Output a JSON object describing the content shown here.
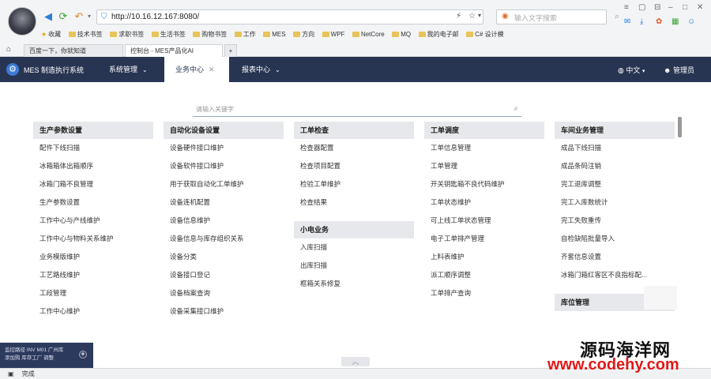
{
  "browser": {
    "url": "http://10.16.12.167:8080/",
    "search_placeholder": "输入文字搜索",
    "bookmarks": [
      {
        "label": "收藏",
        "icon": "star-icon"
      },
      {
        "label": "技术书签",
        "icon": "folder-icon"
      },
      {
        "label": "求职书签",
        "icon": "folder-icon"
      },
      {
        "label": "生活书签",
        "icon": "folder-icon"
      },
      {
        "label": "购物书签",
        "icon": "folder-icon"
      },
      {
        "label": "工作",
        "icon": "folder-icon"
      },
      {
        "label": "MES",
        "icon": "folder-icon"
      },
      {
        "label": "方向",
        "icon": "folder-icon"
      },
      {
        "label": "WPF",
        "icon": "folder-icon"
      },
      {
        "label": "NetCore",
        "icon": "folder-icon"
      },
      {
        "label": "MQ",
        "icon": "folder-icon"
      },
      {
        "label": "我的电子邮",
        "icon": "folder-icon"
      },
      {
        "label": "C# 设计模",
        "icon": "folder-icon"
      }
    ],
    "tabs": [
      {
        "label": "百度一下，你就知道"
      },
      {
        "label": "控制台 - MES产品化AI"
      }
    ],
    "status_text": "完成"
  },
  "app": {
    "title": "MES 制造执行系统",
    "menus": [
      {
        "label": "系统管理",
        "active": false
      },
      {
        "label": "业务中心",
        "active": true
      },
      {
        "label": "报表中心",
        "active": false
      }
    ],
    "language": "中文",
    "user": "管理员",
    "search_placeholder": "请输入关键字"
  },
  "columns": [
    [
      {
        "title": "生产参数设置",
        "items": [
          "配件下线扫描",
          "冰箱箱体出箱顺序",
          "冰箱门箱不良管理",
          "生产参数设置",
          "工作中心与产线维护",
          "工作中心与物料关系维护",
          "业务模版维护",
          "工艺路线维护",
          "工段管理",
          "工作中心维护"
        ]
      }
    ],
    [
      {
        "title": "自动化设备设置",
        "items": [
          "设备硬件接口维护",
          "设备软件接口维护",
          "用于获取自动化工单维护",
          "设备连机配置",
          "设备信息维护",
          "设备信息与库存组织关系",
          "设备分类",
          "设备接口登记",
          "设备档案查询",
          "设备采集接口维护"
        ]
      }
    ],
    [
      {
        "title": "工单检查",
        "items": [
          "检查器配置",
          "检查项目配置",
          "检验工单维护",
          "检查结果"
        ]
      },
      {
        "title": "小电业务",
        "items": [
          "入库扫描",
          "出库扫描",
          "框箱关系修复"
        ]
      }
    ],
    [
      {
        "title": "工单调度",
        "items": [
          "工单信息管理",
          "工单管理",
          "开关钥匙箱不良代码维护",
          "工单状态维护",
          "可上线工单状态管理",
          "电子工单排产管理",
          "上料表维护",
          "派工顺序调整",
          "工单排产查询"
        ]
      }
    ],
    [
      {
        "title": "车间业务管理",
        "items": [
          "成品下线扫描",
          "成品条码注销",
          "完工退库调整",
          "完工入库数统计",
          "完工失败重传",
          "自检缺陷批量导入",
          "齐套信息设置",
          "冰箱门箱红客区不良指标配..."
        ]
      },
      {
        "title": "库位管理",
        "items": []
      }
    ]
  ],
  "notification": {
    "line1": "监控路径 INV M01 广州库",
    "line2": "添加购 库存工厂 调整"
  },
  "watermark": {
    "line1": "源码海洋网",
    "line2": "www.codehy.com"
  }
}
